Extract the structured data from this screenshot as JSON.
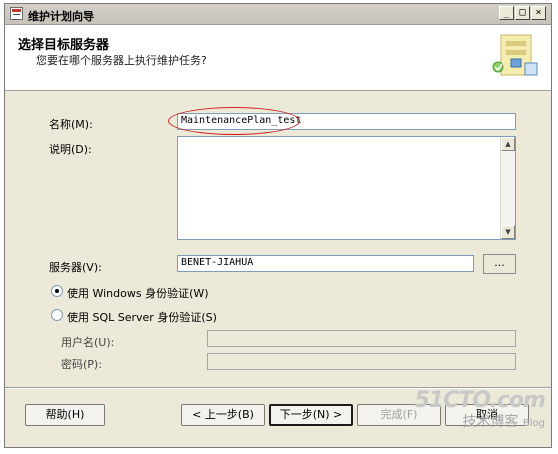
{
  "window": {
    "title": "维护计划向导",
    "controls": [
      "_",
      "□",
      "×"
    ]
  },
  "header": {
    "title": "选择目标服务器",
    "subtitle": "您要在哪个服务器上执行维护任务?",
    "icon": "wizard-server-graphic"
  },
  "form": {
    "name_label": "名称(M):",
    "name_value": "MaintenancePlan_test",
    "description_label": "说明(D):",
    "description_value": "",
    "server_label": "服务器(V):",
    "server_value": "BENET-JIAHUA",
    "browse_label": "...",
    "auth": [
      {
        "label": "使用 Windows 身份验证(W)",
        "selected": true
      },
      {
        "label": "使用 SQL Server 身份验证(S)",
        "selected": false
      }
    ],
    "username_label": "用户名(U):",
    "username_value": "",
    "password_label": "密码(P):",
    "password_value": ""
  },
  "footer": {
    "help_label": "帮助(H)",
    "back_label": "< 上一步(B)",
    "next_label": "下一步(N) >",
    "finish_label": "完成(F)",
    "cancel_label": "取消"
  },
  "watermark": {
    "line1": "51CTO.com",
    "line2": "技术博客",
    "line3": "Blog"
  }
}
